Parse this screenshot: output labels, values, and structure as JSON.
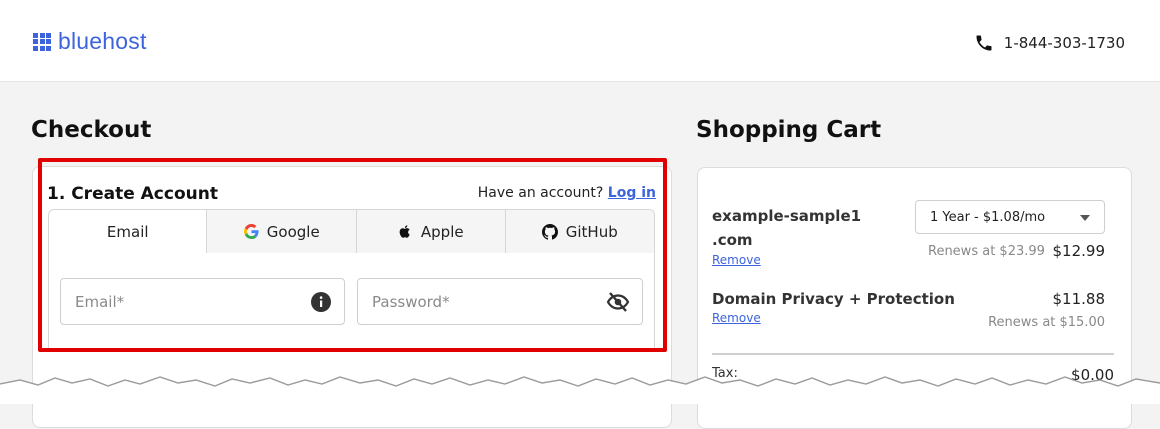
{
  "header": {
    "logo_text": "bluehost",
    "brand_color": "#3d63dd",
    "phone_icon": "phone-icon",
    "phone": "1-844-303-1730"
  },
  "checkout": {
    "title": "Checkout",
    "section_title": "1. Create Account",
    "have_account_text": "Have an account?",
    "login_link": "Log in",
    "tabs": [
      {
        "label": "Email",
        "icon": "",
        "active": true
      },
      {
        "label": "Google",
        "icon": "google-icon",
        "active": false
      },
      {
        "label": "Apple",
        "icon": "apple-icon",
        "active": false
      },
      {
        "label": "GitHub",
        "icon": "github-icon",
        "active": false
      }
    ],
    "email_placeholder": "Email*",
    "password_placeholder": "Password*",
    "highlight_color": "#e00000"
  },
  "cart": {
    "title": "Shopping Cart",
    "items": [
      {
        "name_line1": "example-sample1",
        "name_line2": ".com",
        "remove": "Remove",
        "term_selected": "1 Year - $1.08/mo",
        "renews": "Renews at $23.99",
        "price": "$12.99"
      },
      {
        "name_line1": "Domain Privacy + Protection",
        "remove": "Remove",
        "renews": "Renews at $15.00",
        "price": "$11.88"
      }
    ],
    "tax_label": "Tax:",
    "tax_value": "$0.00"
  }
}
